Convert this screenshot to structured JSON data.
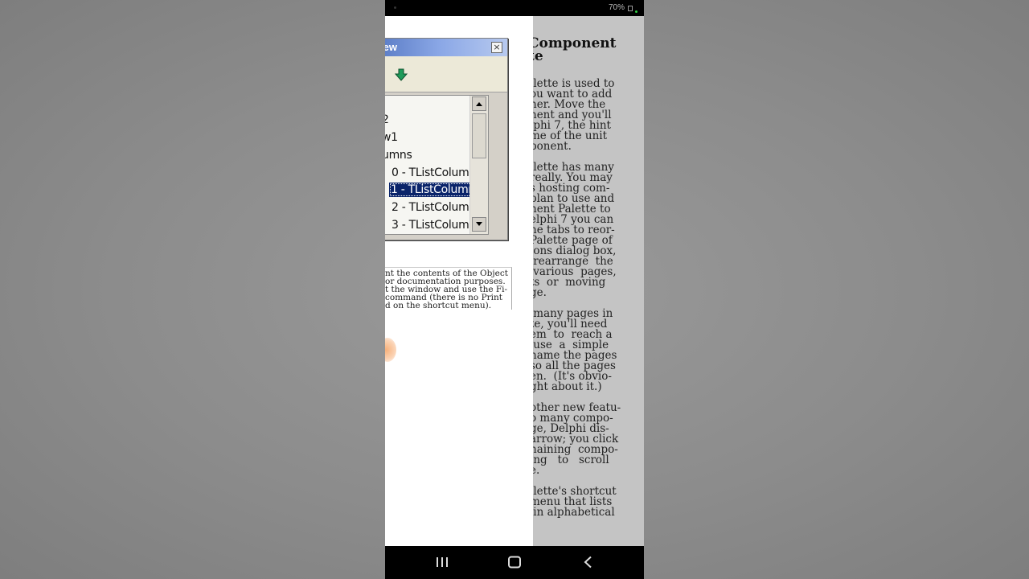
{
  "status_bar": {
    "battery": "70%"
  },
  "tree_view": {
    "title": "iew",
    "close_glyph": "×",
    "items": [
      {
        "label": "2"
      },
      {
        "label": "w1"
      },
      {
        "label": "umns"
      },
      {
        "label": "0 - TListColumn"
      },
      {
        "label": "1 - TListColumn",
        "selected": true
      },
      {
        "label": "2 - TListColumn"
      },
      {
        "label": "3 - TListColumn"
      }
    ]
  },
  "caption": "nt the contents of the Object\nor documentation purposes.\nt the window and use the Fi-\ncommand (there is no Print\nd on the shortcut menu).",
  "right_page": {
    "heading": "Component\nte",
    "body": "llette is used to\nou want to add\nner. Move the\nnent and you'll\nlphi 7, the hint\nme of the unit\nponent.\n\nllette has many\nreally. You may\ns hosting com-\nplan to use and\nnent Palette to\nelphi 7 you can\nhe tabs to reor-\nPalette page of\nions dialog box,\n rearrange  the\n various  pages,\nts  or  moving\nge.\n\n many pages in\nte, you'll need\nem  to  reach a\n use  a  simple\nname the pages\nso all the pages\nen.  (It's obvio-\nght about it.)\n\nother new featu-\no many compo-\nge, Delphi dis-\narrow; you click\nnaining  compo-\ning   to   scroll\ne.\n\nllette's shortcut\nmenu that lists\n in alphabetical"
  },
  "colors": {
    "title_bar_start": "#3a5fb0",
    "selection": "#0a246a",
    "right_page_bg": "#c4c4c4",
    "battery_led": "#2ecc40"
  }
}
